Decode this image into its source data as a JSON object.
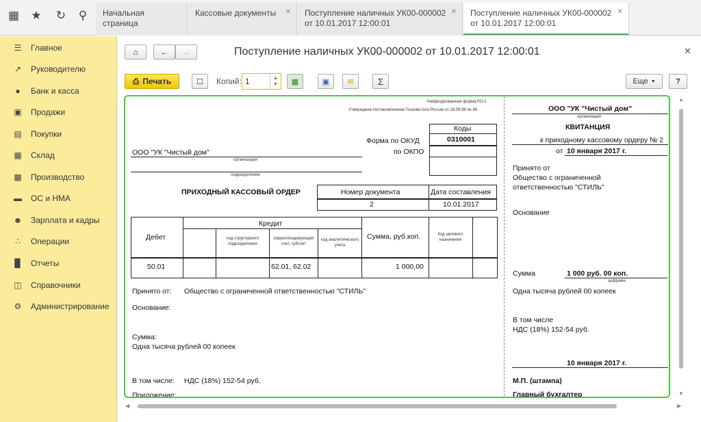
{
  "tabs": [
    {
      "label": "Начальная страница"
    },
    {
      "label": "Кассовые документы"
    },
    {
      "line1": "Поступление наличных УК00-000002",
      "line2": "от 10.01.2017 12:00:01"
    },
    {
      "line1": "Поступление наличных УК00-000002",
      "line2": "от 10.01.2017 12:00:01"
    }
  ],
  "sidebar": {
    "items": [
      {
        "label": "Главное",
        "icon": "menu-icon"
      },
      {
        "label": "Руководителю",
        "icon": "chart-line-icon"
      },
      {
        "label": "Банк и касса",
        "icon": "ruble-coin-icon"
      },
      {
        "label": "Продажи",
        "icon": "cart-icon"
      },
      {
        "label": "Покупки",
        "icon": "basket-icon"
      },
      {
        "label": "Склад",
        "icon": "boxes-icon"
      },
      {
        "label": "Производство",
        "icon": "factory-icon"
      },
      {
        "label": "ОС и НМА",
        "icon": "truck-icon"
      },
      {
        "label": "Зарплата и кадры",
        "icon": "person-icon"
      },
      {
        "label": "Операции",
        "icon": "operations-icon"
      },
      {
        "label": "Отчеты",
        "icon": "bar-chart-icon"
      },
      {
        "label": "Справочники",
        "icon": "book-icon"
      },
      {
        "label": "Администрирование",
        "icon": "gear-icon"
      }
    ]
  },
  "header": {
    "title": "Поступление наличных УК00-000002 от 10.01.2017 12:00:01"
  },
  "toolbar": {
    "print_label": "Печать",
    "copies_label": "Копий:",
    "copies_value": "1",
    "more_label": "Еще",
    "help_label": "?",
    "sum_label": "Σ"
  },
  "order": {
    "form_line1": "Унифицированная форма КО-1",
    "form_line2": "Утверждена постановлением Госкомстата России от 18.08.98 № 88",
    "codes_header": "Коды",
    "okud_label": "Форма по ОКУД",
    "okud_value": "0310001",
    "okpo_label": "по ОКПО",
    "org_name": "ООО \"УК \"Чистый дом\"",
    "org_caption": "организация",
    "dept_caption": "подразделение",
    "title": "ПРИХОДНЫЙ КАССОВЫЙ ОРДЕР",
    "doc_number_header": "Номер документа",
    "doc_date_header": "Дата составления",
    "doc_number": "2",
    "doc_date": "10.01.2017",
    "debit_header": "Дебет",
    "credit_header": "Кредит",
    "col_struct": "код структурного подразделения",
    "col_corr": "корреспондирующий счет, субсчет",
    "col_analyt": "код аналитического учета",
    "sum_header": "Сумма, руб.коп.",
    "target_header": "Код целевого назначения",
    "row_debit": "50.01",
    "row_corr": "62.01, 62.02",
    "row_sum": "1 000,00",
    "received_label": "Принято от:",
    "received_value": "Общество с ограниченной ответственностью \"СТИЛЬ\"",
    "basis_label": "Основание:",
    "sum_label": "Сумма:",
    "sum_words": "Одна тысяча рублей 00 копеек",
    "incl_label": "В том числе:",
    "incl_value": "НДС (18%) 152-54 руб.",
    "attach_label": "Приложение:"
  },
  "receipt": {
    "org_name": "ООО \"УК \"Чистый дом\"",
    "org_caption": "организация",
    "title": "КВИТАНЦИЯ",
    "to_order": "к приходному кассовому ордеру № 2",
    "date_prefix": "от",
    "date": "10 января 2017 г.",
    "received_label": "Принято от",
    "received_line1": "Общество с ограниченной",
    "received_line2": "ответственностью \"СТИЛЬ\"",
    "basis_label": "Основание",
    "sum_label": "Сумма",
    "sum_value": "1 000 руб. 00 коп.",
    "digits_caption": "цифрами",
    "sum_words": "Одна тысяча рублей 00 копеек",
    "incl_label": "В том числе",
    "incl_value": "НДС (18%) 152-54 руб.",
    "date_bottom": "10 января 2017 г.",
    "stamp": "М.П. (штампа)",
    "chief_accountant": "Главный бухгалтер"
  }
}
